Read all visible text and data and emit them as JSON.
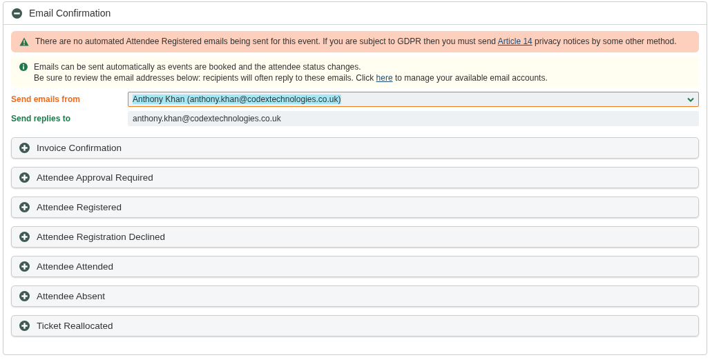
{
  "panel": {
    "title": "Email Confirmation",
    "expanded": true
  },
  "warning": {
    "before": "There are no automated Attendee Registered emails being sent for this event. If you are subject to GDPR then you must send ",
    "link": "Article 14",
    "after": " privacy notices by some other method."
  },
  "info": {
    "line1": "Emails can be sent automatically as events are booked and the attendee status changes.",
    "before": "Be sure to review the email addresses below: recipients will often reply to these emails. Click ",
    "link": "here",
    "after": " to manage your available email accounts."
  },
  "fields": [
    {
      "kind": "select",
      "label": "Send emails from",
      "value": "Anthony Khan (anthony.khan@codextechnologies.co.uk)",
      "focused": true
    },
    {
      "kind": "text",
      "label": "Send replies to",
      "value": "anthony.khan@codextechnologies.co.uk",
      "focused": false
    }
  ],
  "sections": [
    {
      "title": "Invoice Confirmation",
      "expanded": false
    },
    {
      "title": "Attendee Approval Required",
      "expanded": false
    },
    {
      "title": "Attendee Registered",
      "expanded": false
    },
    {
      "title": "Attendee Registration Declined",
      "expanded": false
    },
    {
      "title": "Attendee Attended",
      "expanded": false
    },
    {
      "title": "Attendee Absent",
      "expanded": false
    },
    {
      "title": "Ticket Reallocated",
      "expanded": false
    }
  ]
}
